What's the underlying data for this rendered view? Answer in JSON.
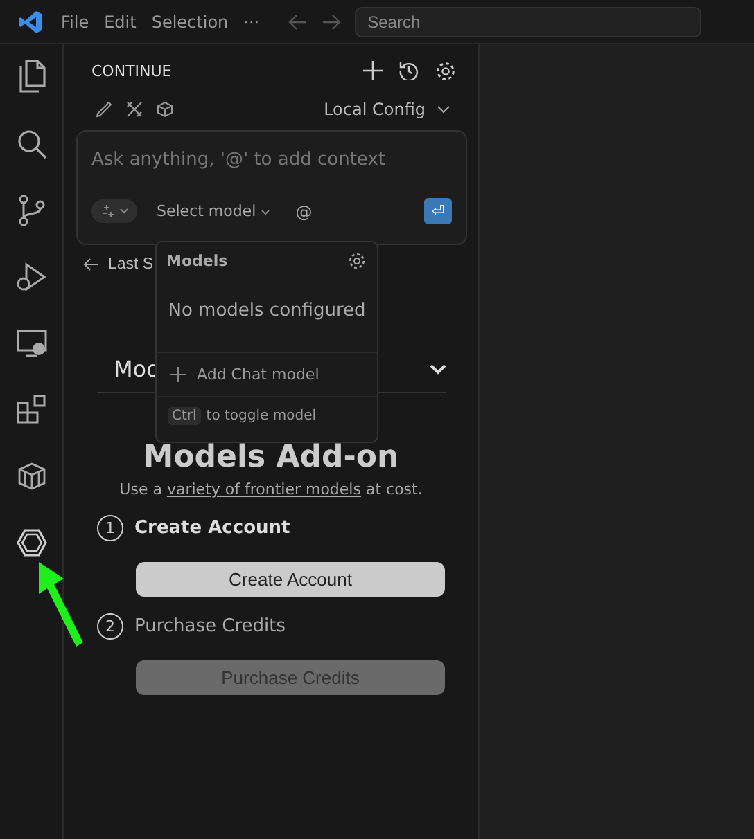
{
  "menu_bar": {
    "items": [
      "File",
      "Edit",
      "Selection",
      "···"
    ],
    "search": {
      "placeholder": "Search"
    }
  },
  "sidebar": {
    "title": "CONTINUE",
    "config": "Local Config",
    "chat_input": {
      "placeholder": "Ask anything, '@' to add context",
      "model_selector": "Select model",
      "mention": "@",
      "submit_icon": "⏎"
    },
    "back_link": "Last S",
    "section_title": "Mod",
    "addon": {
      "title": "Models Add-on",
      "subtitle_before": "Use a ",
      "subtitle_link": "variety of frontier models",
      "subtitle_after": " at cost.",
      "steps": [
        {
          "number": "1",
          "label": "Create Account",
          "button": "Create Account",
          "disabled": false
        },
        {
          "number": "2",
          "label": "Purchase Credits",
          "button": "Purchase Credits",
          "disabled": true
        }
      ]
    }
  },
  "models_popup": {
    "title": "Models",
    "empty": "No models configured",
    "add": "Add Chat model",
    "key": "Ctrl",
    "hint": "to toggle model"
  }
}
